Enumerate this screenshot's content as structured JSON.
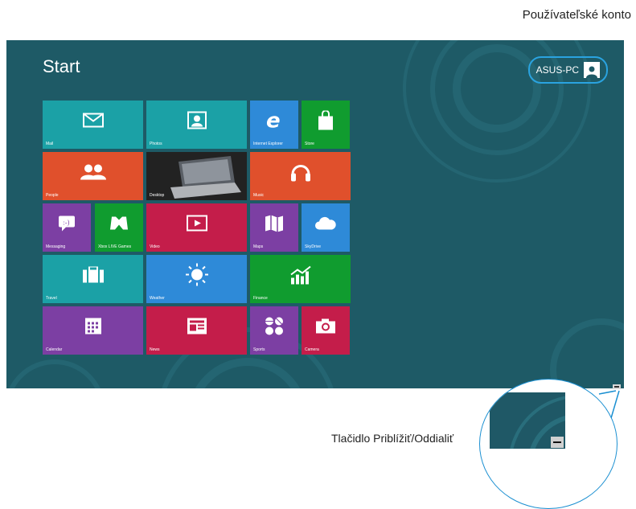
{
  "callouts": {
    "user_account": "Používateľské konto",
    "zoom_button": "Tlačidlo Priblížiť/Oddialiť"
  },
  "start": {
    "title": "Start",
    "user_name": "ASUS-PC"
  },
  "tiles": {
    "mail": "Mail",
    "photos": "Photos",
    "ie": "Internet Explorer",
    "store": "Store",
    "people": "People",
    "desktop": "Desktop",
    "music": "Music",
    "messaging": "Messaging",
    "xbox": "Xbox LIVE Games",
    "video": "Video",
    "maps": "Maps",
    "skydrive": "SkyDrive",
    "travel": "Travel",
    "weather": "Weather",
    "finance": "Finance",
    "calendar": "Calendar",
    "news": "News",
    "sports": "Sports",
    "camera": "Camera"
  },
  "colors": {
    "background": "#1e5a66",
    "teal": "#1ba1a6",
    "green": "#109c2f",
    "orange": "#e0502c",
    "purple": "#7c3fa3",
    "crimson": "#c41d4a",
    "blue": "#2e8ad8",
    "highlight": "#2aa3e0"
  }
}
